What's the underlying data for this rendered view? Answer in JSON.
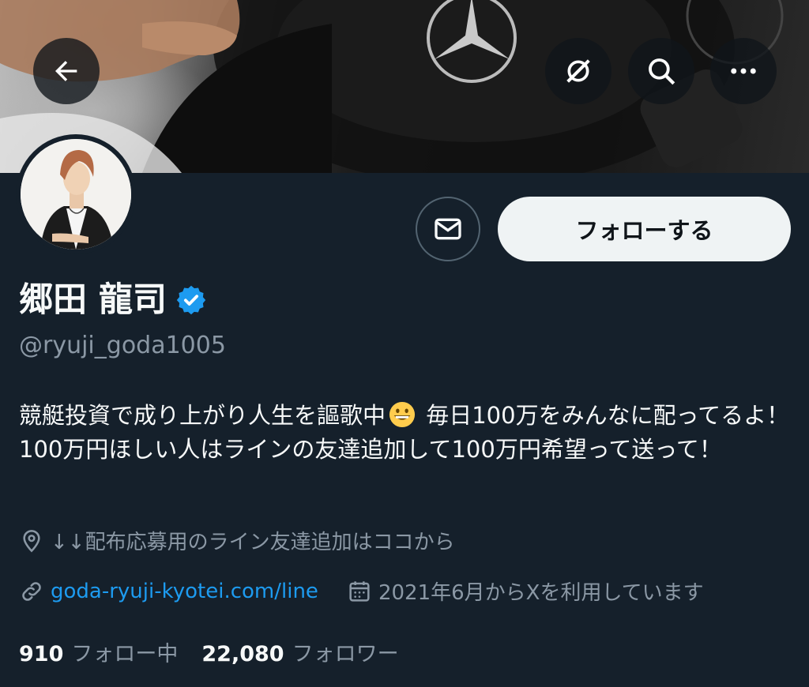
{
  "profile": {
    "display_name": "郷田 龍司",
    "handle": "@ryuji_goda1005",
    "bio_part1": "競艇投資で成り上がり人生を謳歌中",
    "bio_part2": " 毎日100万をみんなに配ってるよ！100万円ほしい人はラインの友達追加して100万円希望って送って！",
    "location": "↓↓配布応募用のライン友達追加はココから",
    "website": "goda-ryuji-kyotei.com/line",
    "joined": "2021年6月からXを利用しています",
    "following_count": "910",
    "following_label": "フォロー中",
    "followers_count": "22,080",
    "followers_label": "フォロワー"
  },
  "actions": {
    "follow_label": "フォローする"
  },
  "icons": {
    "back": "arrow-left-icon",
    "hide": "eye-off-icon",
    "search": "search-icon",
    "more": "more-icon",
    "message": "envelope-icon",
    "verified": "verified-badge-icon",
    "location": "location-pin-icon",
    "link": "link-icon",
    "calendar": "calendar-icon"
  },
  "colors": {
    "background": "#15202b",
    "accent": "#1d9bf0",
    "secondary_text": "#8b98a5",
    "follow_button": "#eff3f4"
  }
}
